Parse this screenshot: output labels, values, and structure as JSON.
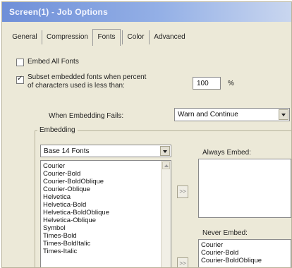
{
  "window": {
    "title": "Screen(1) - Job Options"
  },
  "tabs": [
    {
      "label": "General"
    },
    {
      "label": "Compression"
    },
    {
      "label": "Fonts"
    },
    {
      "label": "Color"
    },
    {
      "label": "Advanced"
    }
  ],
  "fonts": {
    "embed_all_label": "Embed All Fonts",
    "embed_all_checked": false,
    "subset_label_line1": "Subset embedded fonts when percent",
    "subset_label_line2": "of characters used is less than:",
    "subset_checked": true,
    "subset_value": "100",
    "subset_unit": "%",
    "when_fails_label": "When Embedding Fails:",
    "when_fails_value": "Warn and Continue",
    "embedding_group_label": "Embedding",
    "source_select_value": "Base 14 Fonts",
    "source_list": [
      "Courier",
      "Courier-Bold",
      "Courier-BoldOblique",
      "Courier-Oblique",
      "Helvetica",
      "Helvetica-Bold",
      "Helvetica-BoldOblique",
      "Helvetica-Oblique",
      "Symbol",
      "Times-Bold",
      "Times-BoldItalic",
      "Times-Italic"
    ],
    "move_to_always_label": ">>",
    "move_to_never_label": ">>",
    "always_embed_label": "Always Embed:",
    "always_embed_list": [],
    "never_embed_label": "Never Embed:",
    "never_embed_list": [
      "Courier",
      "Courier-Bold",
      "Courier-BoldOblique"
    ]
  }
}
